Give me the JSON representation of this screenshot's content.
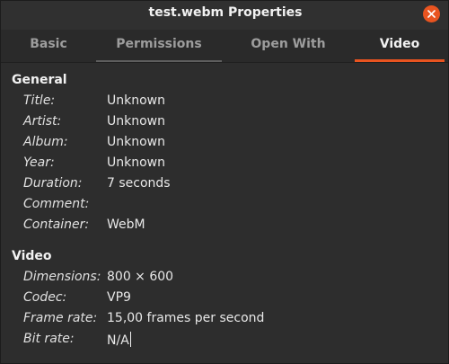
{
  "window": {
    "title": "test.webm Properties"
  },
  "tabs": [
    {
      "label": "Basic"
    },
    {
      "label": "Permissions"
    },
    {
      "label": "Open With"
    },
    {
      "label": "Video"
    }
  ],
  "general": {
    "heading": "General",
    "rows": [
      {
        "label": "Title:",
        "value": "Unknown"
      },
      {
        "label": "Artist:",
        "value": "Unknown"
      },
      {
        "label": "Album:",
        "value": "Unknown"
      },
      {
        "label": "Year:",
        "value": "Unknown"
      },
      {
        "label": "Duration:",
        "value": "7 seconds"
      },
      {
        "label": "Comment:",
        "value": ""
      },
      {
        "label": "Container:",
        "value": "WebM"
      }
    ]
  },
  "video": {
    "heading": "Video",
    "rows": [
      {
        "label": "Dimensions:",
        "value": "800 × 600"
      },
      {
        "label": "Codec:",
        "value": "VP9"
      },
      {
        "label": "Frame rate:",
        "value": "15,00 frames per second"
      },
      {
        "label": "Bit rate:",
        "value": "N/A"
      }
    ]
  },
  "colors": {
    "accent": "#e95420",
    "background": "#2d2d2d"
  }
}
